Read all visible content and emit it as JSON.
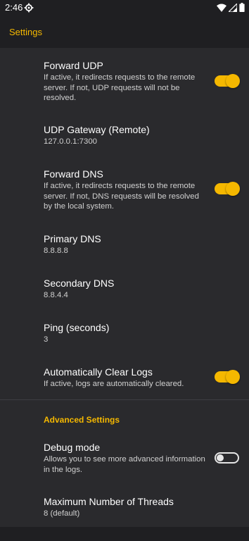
{
  "status_bar": {
    "time": "2:46",
    "icons": [
      "gear-icon",
      "wifi-icon",
      "signal-icon",
      "battery-icon"
    ]
  },
  "app_bar": {
    "title": "Settings"
  },
  "colors": {
    "accent": "#f5b800",
    "background": "#2a2a2d",
    "bar": "#1f1f22"
  },
  "prefs": [
    {
      "title": "Forward UDP",
      "summary": "If active, it redirects requests to the remote server. If not, UDP requests will not be resolved.",
      "switch": "on"
    },
    {
      "title": "UDP Gateway (Remote)",
      "summary": "127.0.0.1:7300"
    },
    {
      "title": "Forward DNS",
      "summary": "If active, it redirects requests to the remote server. If not, DNS requests will be resolved by the local system.",
      "switch": "on"
    },
    {
      "title": "Primary DNS",
      "summary": "8.8.8.8"
    },
    {
      "title": "Secondary DNS",
      "summary": "8.8.4.4"
    },
    {
      "title": "Ping (seconds)",
      "summary": "3"
    },
    {
      "title": "Automatically Clear Logs",
      "summary": "If active, logs are automatically cleared.",
      "switch": "on"
    }
  ],
  "advanced": {
    "header": "Advanced Settings",
    "prefs": [
      {
        "title": "Debug mode",
        "summary": "Allows you to see more advanced information in the logs.",
        "switch": "off"
      },
      {
        "title": "Maximum Number of Threads",
        "summary": "8 (default)"
      }
    ]
  }
}
